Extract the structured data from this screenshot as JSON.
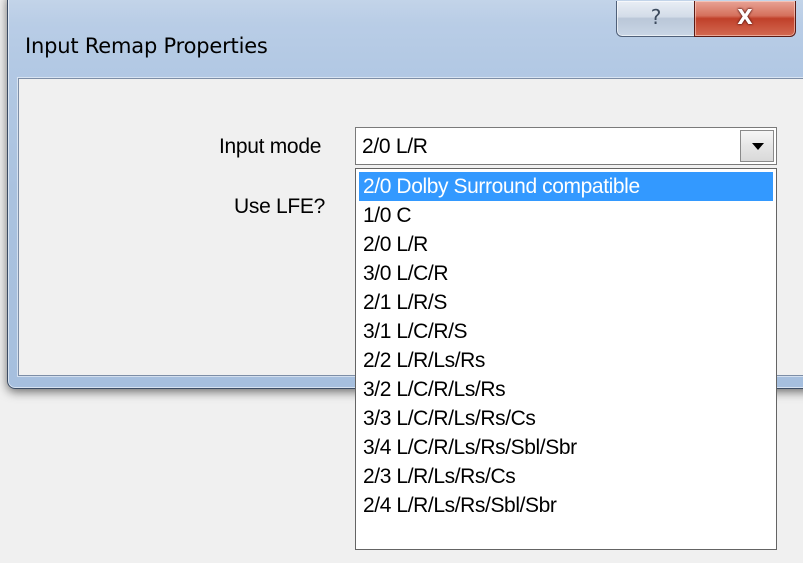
{
  "window": {
    "title": "Input Remap Properties",
    "help_button": "?",
    "close_button": "X"
  },
  "form": {
    "input_mode_label": "Input mode",
    "use_lfe_label": "Use LFE?",
    "input_mode_value": "2/0 L/R"
  },
  "dropdown": {
    "highlighted_index": 0,
    "options": [
      "2/0 Dolby Surround compatible",
      "1/0 C",
      "2/0 L/R",
      "3/0 L/C/R",
      "2/1 L/R/S",
      "3/1 L/C/R/S",
      "2/2 L/R/Ls/Rs",
      "3/2 L/C/R/Ls/Rs",
      "3/3 L/C/R/Ls/Rs/Cs",
      "3/4 L/C/R/Ls/Rs/Sbl/Sbr",
      "2/3 L/R/Ls/Rs/Cs",
      "2/4 L/R/Ls/Rs/Sbl/Sbr"
    ]
  },
  "colors": {
    "highlight": "#3399ff",
    "close_button": "#c0402a",
    "window_frame": "#b9cde6"
  }
}
